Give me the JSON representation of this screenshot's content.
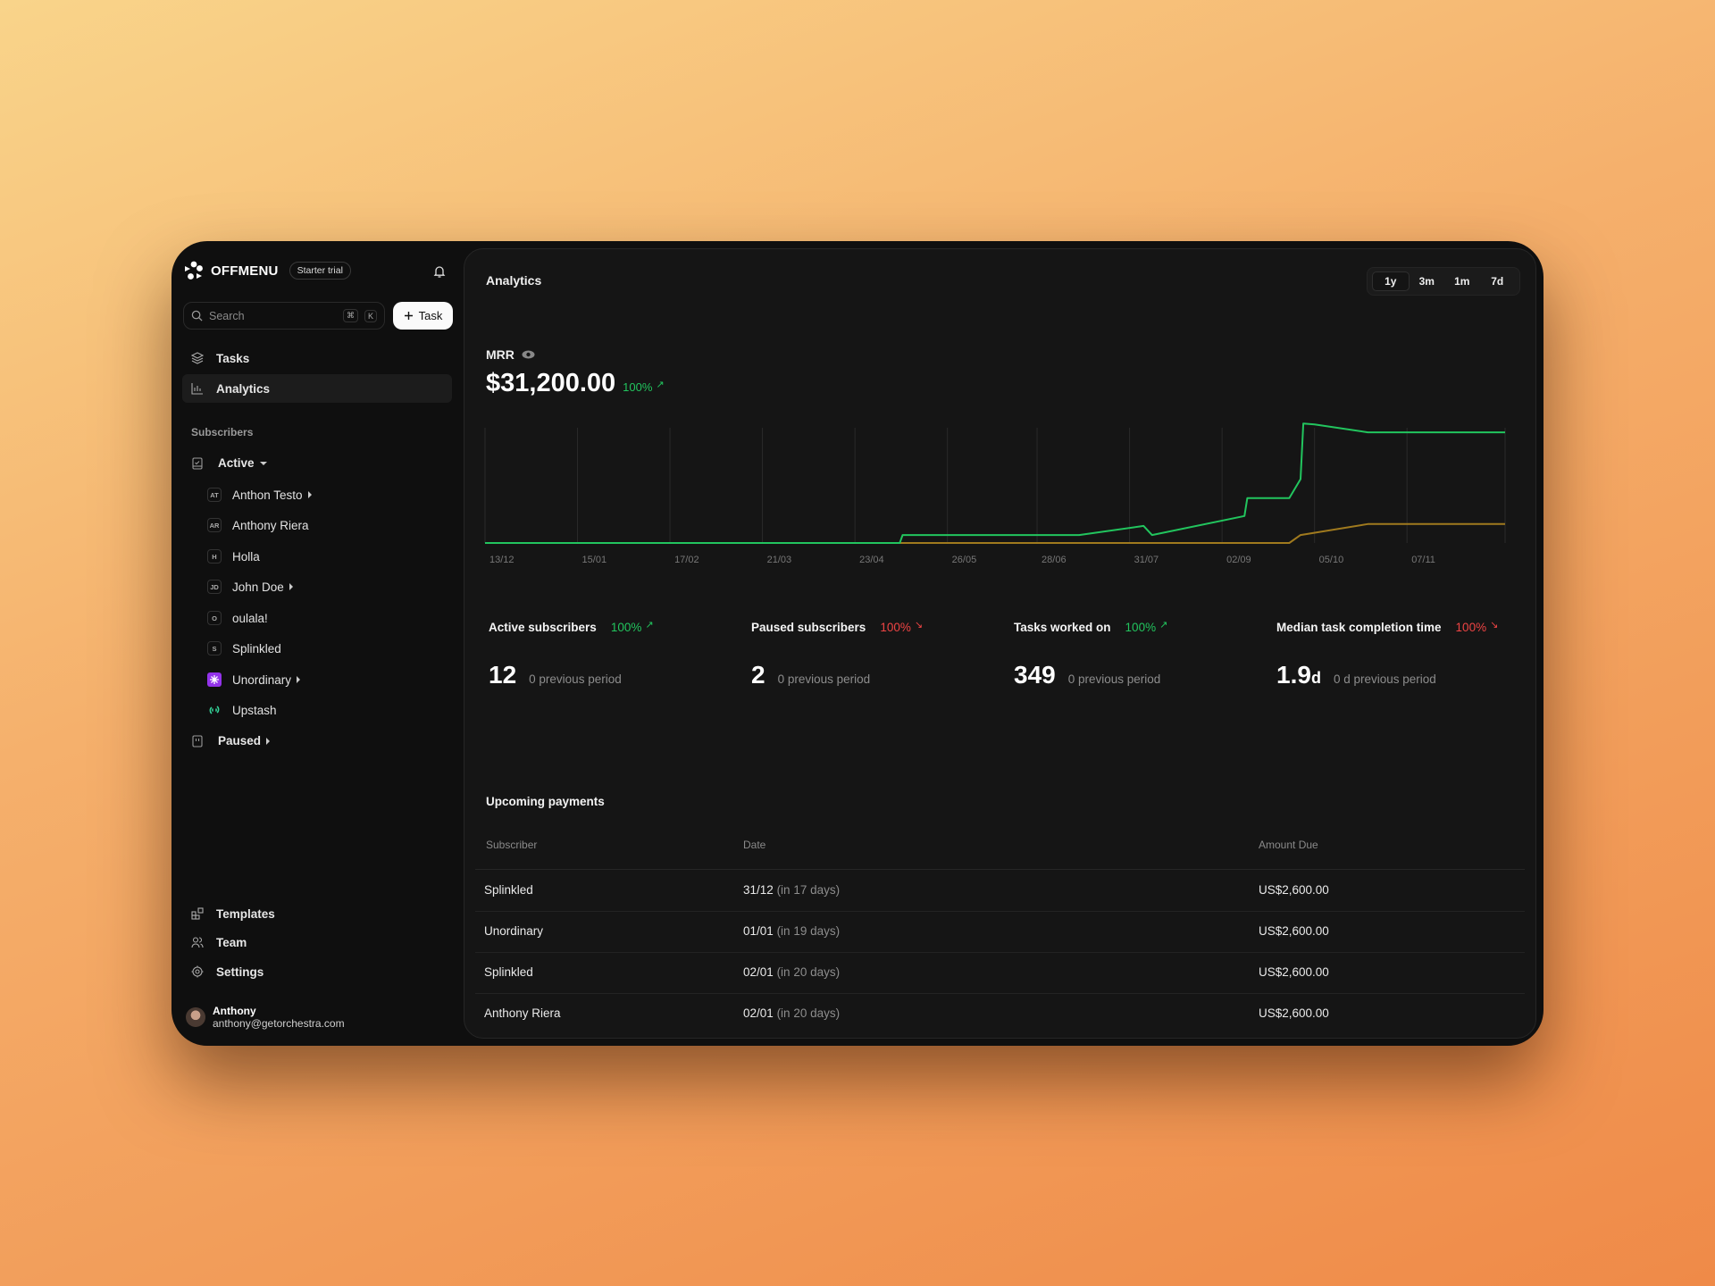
{
  "brand": {
    "name": "OFFMENU",
    "badge": "Starter trial"
  },
  "search": {
    "placeholder": "Search",
    "shortcut_keys": [
      "⌘",
      "K"
    ]
  },
  "new_task_button": {
    "label": "Task",
    "icon": "plus-icon"
  },
  "nav": [
    {
      "label": "Tasks",
      "icon": "layers-icon",
      "active": false
    },
    {
      "label": "Analytics",
      "icon": "bar-chart-icon",
      "active": true
    }
  ],
  "subscribers": {
    "section_label": "Subscribers",
    "active_group": {
      "label": "Active",
      "items": [
        {
          "initials": "AT",
          "label": "Anthon Testo",
          "expandable": true
        },
        {
          "initials": "AR",
          "label": "Anthony Riera",
          "expandable": false
        },
        {
          "initials": "H",
          "label": "Holla",
          "expandable": false
        },
        {
          "initials": "JD",
          "label": "John Doe",
          "expandable": true
        },
        {
          "initials": "O",
          "label": "oulala!",
          "expandable": false
        },
        {
          "initials": "S",
          "label": "Splinkled",
          "expandable": false
        },
        {
          "initials": "",
          "label": "Unordinary",
          "expandable": true,
          "logo": "unordinary-logo-icon",
          "logo_color": "#9333ea"
        },
        {
          "initials": "",
          "label": "Upstash",
          "expandable": false,
          "logo": "upstash-logo-icon",
          "logo_color": "#34d399"
        }
      ]
    },
    "paused_group": {
      "label": "Paused"
    }
  },
  "bottom_nav": [
    {
      "label": "Templates",
      "icon": "templates-icon"
    },
    {
      "label": "Team",
      "icon": "users-icon"
    },
    {
      "label": "Settings",
      "icon": "settings-icon"
    }
  ],
  "user": {
    "name": "Anthony",
    "email": "anthony@getorchestra.com"
  },
  "main": {
    "title": "Analytics",
    "ranges": [
      {
        "label": "1y",
        "active": true
      },
      {
        "label": "3m",
        "active": false
      },
      {
        "label": "1m",
        "active": false
      },
      {
        "label": "7d",
        "active": false
      }
    ],
    "mrr": {
      "label": "MRR",
      "value": "$31,200.00",
      "change": "100%",
      "trend": "up"
    }
  },
  "metrics": [
    {
      "label": "Active subscribers",
      "change": "100%",
      "trend": "up",
      "value": "12",
      "unit": "",
      "previous": "0 previous period"
    },
    {
      "label": "Paused subscribers",
      "change": "100%",
      "trend": "down",
      "value": "2",
      "unit": "",
      "previous": "0 previous period"
    },
    {
      "label": "Tasks worked on",
      "change": "100%",
      "trend": "up",
      "value": "349",
      "unit": "",
      "previous": "0 previous period"
    },
    {
      "label": "Median task completion time",
      "change": "100%",
      "trend": "down",
      "value": "1.9",
      "unit": "d",
      "previous": "0 d previous period"
    }
  ],
  "payments": {
    "title": "Upcoming payments",
    "columns": [
      "Subscriber",
      "Date",
      "Amount Due"
    ],
    "rows": [
      {
        "subscriber": "Splinkled",
        "date": "31/12",
        "relative": "(in 17 days)",
        "amount": "US$2,600.00"
      },
      {
        "subscriber": "Unordinary",
        "date": "01/01",
        "relative": "(in 19 days)",
        "amount": "US$2,600.00"
      },
      {
        "subscriber": "Splinkled",
        "date": "02/01",
        "relative": "(in 20 days)",
        "amount": "US$2,600.00"
      },
      {
        "subscriber": "Anthony Riera",
        "date": "02/01",
        "relative": "(in 20 days)",
        "amount": "US$2,600.00"
      }
    ]
  },
  "colors": {
    "accent_up": "#22c55e",
    "accent_down": "#ef4444",
    "series_mrr": "#22c55e",
    "series_secondary": "#a07a1e"
  },
  "chart_data": {
    "type": "line",
    "title": "MRR",
    "xlabel": "",
    "ylabel": "",
    "x_unit": "days since 13/12",
    "xlim": [
      0,
      364
    ],
    "ylim": [
      0,
      35000
    ],
    "grid": "vertical",
    "tick_days": [
      0,
      33,
      66,
      99,
      132,
      165,
      197,
      230,
      263,
      296,
      329,
      364
    ],
    "tick_labels": [
      "13/12",
      "15/01",
      "17/02",
      "21/03",
      "23/04",
      "26/05",
      "28/06",
      "31/07",
      "02/09",
      "05/10",
      "07/11",
      ""
    ],
    "series": [
      {
        "name": "MRR",
        "color": "#22c55e",
        "x": [
          0,
          148,
          149,
          212,
          235,
          238,
          271,
          272,
          287,
          291,
          292,
          296,
          315,
          364
        ],
        "y": [
          0,
          0,
          2250,
          2250,
          4800,
          2250,
          7600,
          12650,
          12650,
          18000,
          33700,
          33450,
          31200,
          31200
        ]
      },
      {
        "name": "Secondary",
        "color": "#a07a1e",
        "x": [
          0,
          287,
          291,
          315,
          364
        ],
        "y": [
          0,
          0,
          2250,
          5340,
          5340
        ]
      }
    ]
  }
}
